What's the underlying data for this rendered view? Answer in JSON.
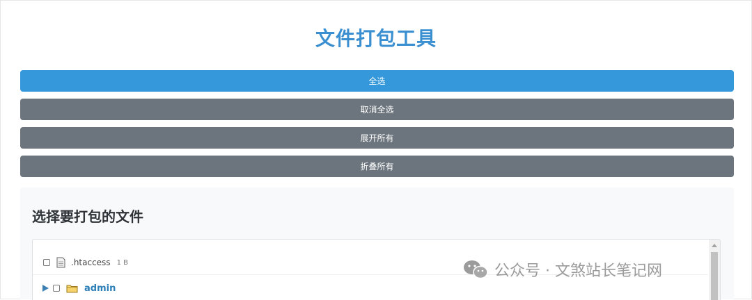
{
  "header": {
    "title": "文件打包工具"
  },
  "actions": {
    "select_all": "全选",
    "deselect_all": "取消全选",
    "expand_all": "展开所有",
    "collapse_all": "折叠所有"
  },
  "file_panel": {
    "title": "选择要打包的文件",
    "items": [
      {
        "type": "file",
        "name": ".htaccess",
        "size": "1 B",
        "icon": "file-icon"
      },
      {
        "type": "folder",
        "name": "admin",
        "icon": "folder-icon",
        "expand_icon": "expand-arrow-icon"
      }
    ]
  },
  "watermark": {
    "text": "公众号 · 文煞站长笔记网",
    "icon": "wechat-icon"
  },
  "colors": {
    "title": "#3a8fd0",
    "primary": "#3498db",
    "secondary": "#6c757d",
    "folder_name": "#2d7fb8"
  }
}
